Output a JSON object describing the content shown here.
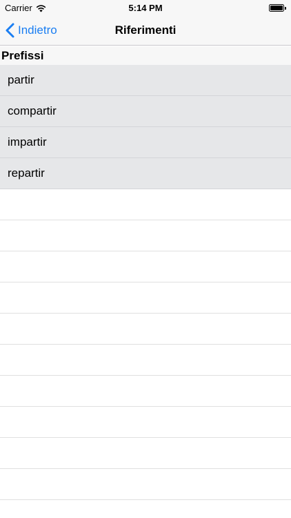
{
  "status_bar": {
    "carrier": "Carrier",
    "time": "5:14 PM",
    "wifi_icon": "wifi-icon",
    "battery_icon": "battery-icon"
  },
  "nav": {
    "back_label": "Indietro",
    "back_icon": "chevron-left-icon",
    "title": "Riferimenti",
    "accent_color": "#1a7ef2"
  },
  "section": {
    "title": "Prefissi"
  },
  "items": [
    {
      "label": "partir"
    },
    {
      "label": "compartir"
    },
    {
      "label": "impartir"
    },
    {
      "label": "repartir"
    }
  ],
  "colors": {
    "row_background": "#e6e7e9",
    "bar_background": "#f7f7f7"
  }
}
